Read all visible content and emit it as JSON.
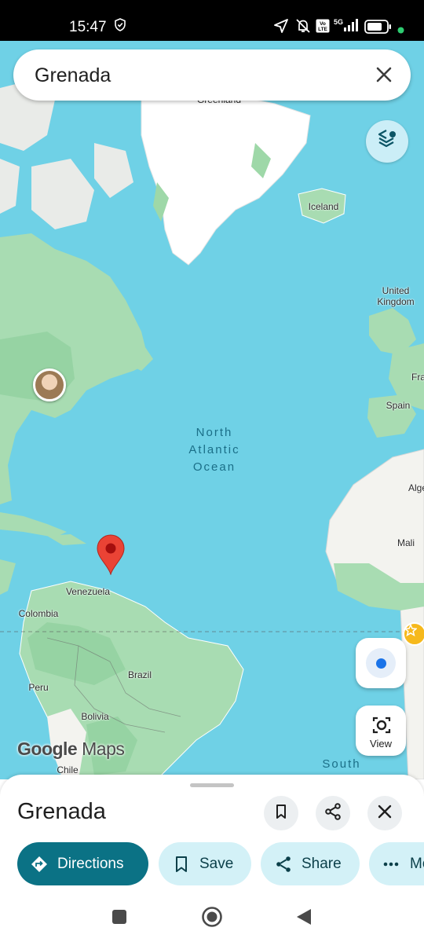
{
  "status_bar": {
    "time": "15:47",
    "network": "5G",
    "volte": "Vo LTE"
  },
  "search": {
    "query": "Grenada",
    "clear_icon": "close-icon"
  },
  "map": {
    "labels": {
      "greenland": "Greenland",
      "iceland": "Iceland",
      "uk": "United Kingdom",
      "france": "Fra",
      "spain": "Spain",
      "algeria": "Alge",
      "mali": "Mali",
      "venezuela": "Venezuela",
      "colombia": "Colombia",
      "brazil": "Brazil",
      "peru": "Peru",
      "bolivia": "Bolivia",
      "chile": "Chile",
      "ocean_north": "North",
      "ocean_atlantic": "Atlantic",
      "ocean_ocean": "Ocean",
      "south": "South"
    },
    "logo_google": "Google",
    "logo_maps": "Maps",
    "pin_color": "#ea4335"
  },
  "controls": {
    "view_label": "View"
  },
  "sheet": {
    "title": "Grenada",
    "actions": {
      "directions": "Directions",
      "save": "Save",
      "share": "Share",
      "more": "Mo"
    }
  },
  "colors": {
    "accent": "#0b7285",
    "chip_bg": "#d3f1f7",
    "water": "#6fd1e6",
    "land_green": "#a8dcb2"
  }
}
